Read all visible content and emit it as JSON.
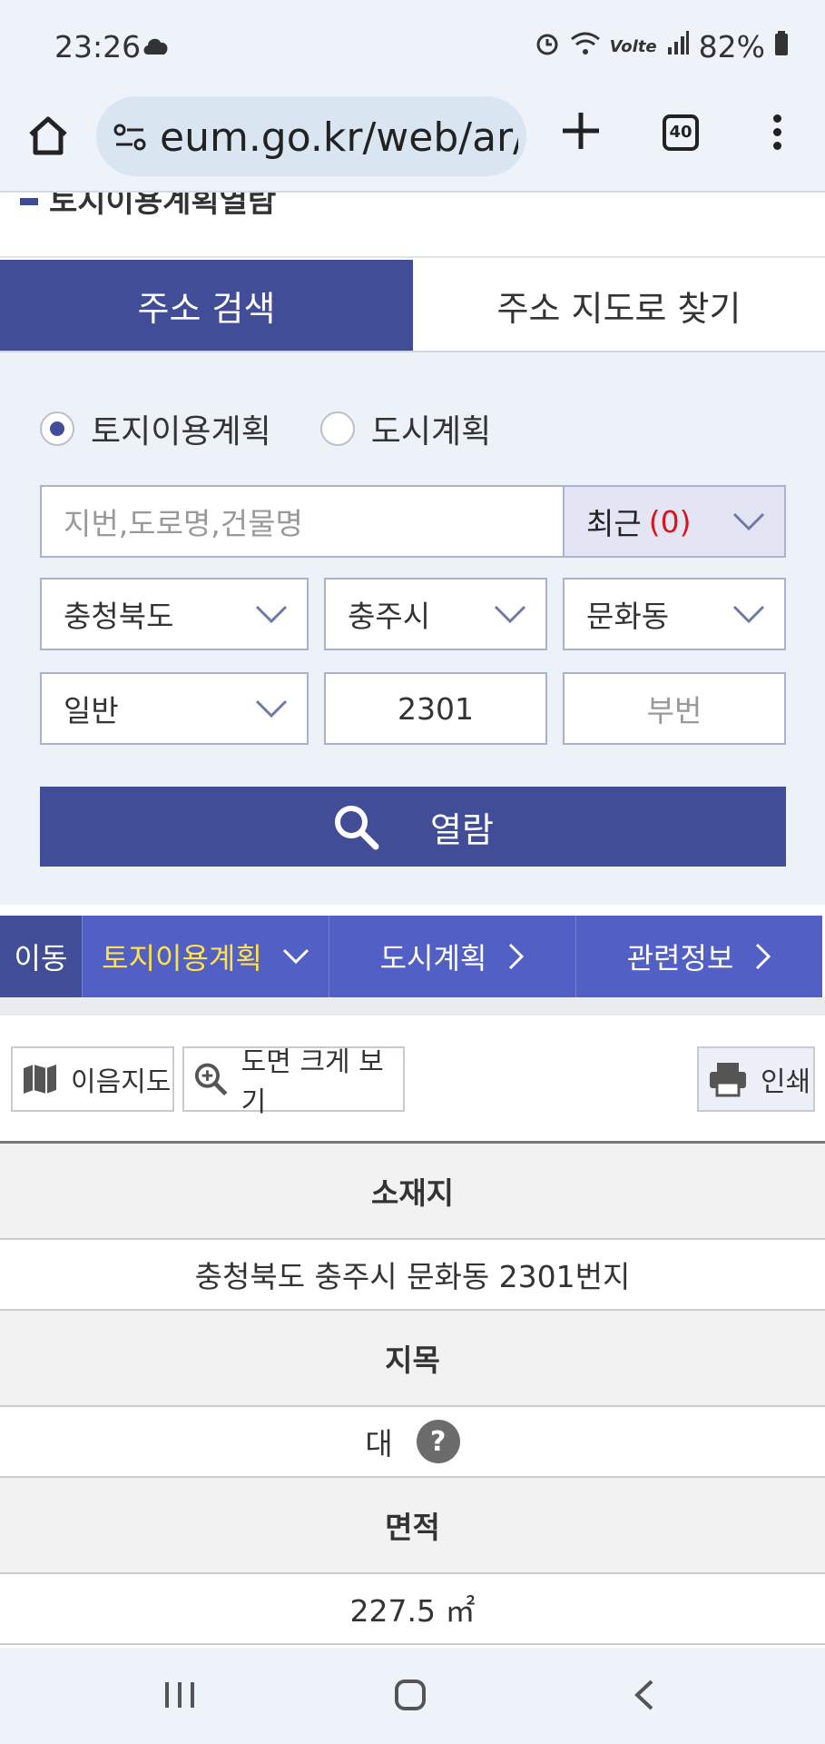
{
  "status_bar": {
    "time": "23:26",
    "battery": "82%",
    "network_label": "Volte"
  },
  "browser": {
    "url": "eum.go.kr/web/ar/",
    "tab_count": "40"
  },
  "page": {
    "title": "토지이용계획열람"
  },
  "search_tabs": {
    "address_search": "주소 검색",
    "map_search": "주소 지도로 찾기"
  },
  "search": {
    "radio_land": "토지이용계획",
    "radio_city": "도시계획",
    "input_placeholder": "지번,도로명,건물명",
    "recent_label": "최근",
    "recent_count": "(0)",
    "province": "충청북도",
    "city": "충주시",
    "dong": "문화동",
    "type": "일반",
    "main_number": "2301",
    "sub_number_placeholder": "부번",
    "submit_label": "열람"
  },
  "nav": {
    "move_label": "이동",
    "items": [
      {
        "label": "토지이용계획"
      },
      {
        "label": "도시계획"
      },
      {
        "label": "관련정보"
      }
    ]
  },
  "tools": {
    "map_label": "이음지도",
    "zoom_label": "도면 크게 보기",
    "print_label": "인쇄"
  },
  "info_table": {
    "location_header": "소재지",
    "location_value": "충청북도 충주시 문화동 2301번지",
    "category_header": "지목",
    "category_value": "대",
    "area_header": "면적",
    "area_value": "227.5 ㎡"
  },
  "colors": {
    "primary": "#414d96",
    "nav_blue": "#525fc4",
    "active_yellow": "#ffe14a",
    "red": "#d8141d"
  }
}
